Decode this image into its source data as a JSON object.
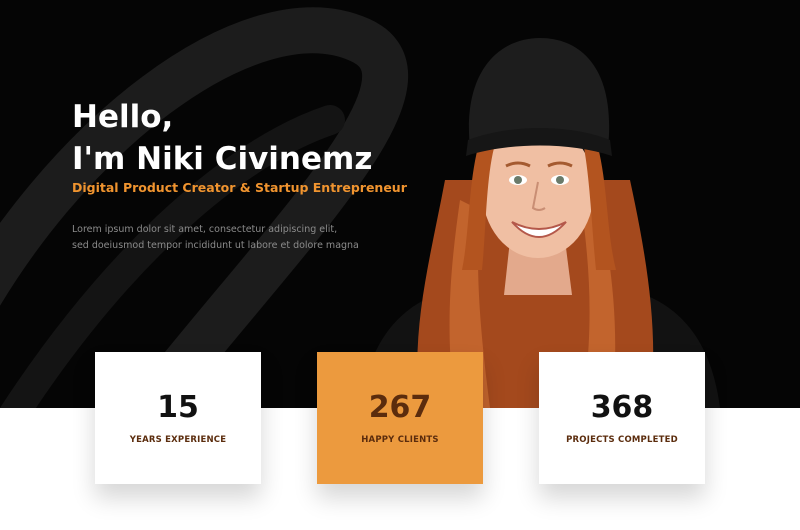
{
  "hero": {
    "greeting": "Hello,",
    "name": "I'm Niki Civinemz",
    "role": "Digital Product Creator & Startup Entrepreneur",
    "description_line1": "Lorem ipsum dolor sit amet, consectetur adipiscing elit,",
    "description_line2": "sed doeiusmod tempor incididunt ut labore et dolore magna"
  },
  "stats": [
    {
      "value": "15",
      "label": "YEARS EXPERIENCE"
    },
    {
      "value": "267",
      "label": "HAPPY CLIENTS"
    },
    {
      "value": "368",
      "label": "PROJECTS COMPLETED"
    }
  ],
  "colors": {
    "hero_background": "#050505",
    "accent": "#ec9a3e",
    "label_text": "#5b2c0d"
  }
}
